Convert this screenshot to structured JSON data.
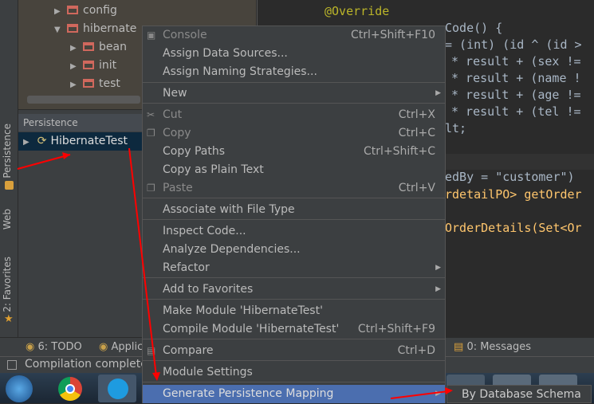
{
  "sidebar": {
    "tabs": [
      "Persistence",
      "Web",
      "2: Favorites"
    ]
  },
  "tree": {
    "items": [
      "config",
      "hibernate",
      "bean",
      "init",
      "test"
    ]
  },
  "persistence": {
    "title": "Persistence",
    "root": "HibernateTest"
  },
  "editor": {
    "lines": [
      "@Override",
      "Code() {",
      "= (int) (id ^ (id >",
      "* result + (name !",
      "* result + (sex !=",
      "* result + (age !=",
      "* result + (tel !=",
      "lt;",
      "edBy = \"customer\")",
      "rdetailPO> getOrder",
      "OrderDetails(Set<Or"
    ]
  },
  "menu": {
    "items": [
      {
        "label": "Console",
        "shortcut": "Ctrl+Shift+F10"
      },
      {
        "label": "Assign Data Sources..."
      },
      {
        "label": "Assign Naming Strategies..."
      },
      {
        "label": "New"
      },
      {
        "label": "Cut",
        "shortcut": "Ctrl+X"
      },
      {
        "label": "Copy",
        "shortcut": "Ctrl+C"
      },
      {
        "label": "Copy Paths",
        "shortcut": "Ctrl+Shift+C"
      },
      {
        "label": "Copy as Plain Text"
      },
      {
        "label": "Paste",
        "shortcut": "Ctrl+V"
      },
      {
        "label": "Associate with File Type"
      },
      {
        "label": "Inspect Code..."
      },
      {
        "label": "Analyze Dependencies..."
      },
      {
        "label": "Refactor"
      },
      {
        "label": "Add to Favorites"
      },
      {
        "label": "Make Module 'HibernateTest'"
      },
      {
        "label": "Compile Module 'HibernateTest'",
        "shortcut": "Ctrl+Shift+F9"
      },
      {
        "label": "Compare",
        "shortcut": "Ctrl+D"
      },
      {
        "label": "Module Settings"
      },
      {
        "label": "Generate Persistence Mapping"
      }
    ]
  },
  "submenu": {
    "label": "By Database Schema"
  },
  "toolwindows": {
    "todo": "6: TODO",
    "app": "Applica",
    "messages": "0: Messages"
  },
  "status": {
    "text": "Compilation complete"
  },
  "colors": {
    "selection": "#4b6eaf",
    "arrow": "#ff0000"
  }
}
